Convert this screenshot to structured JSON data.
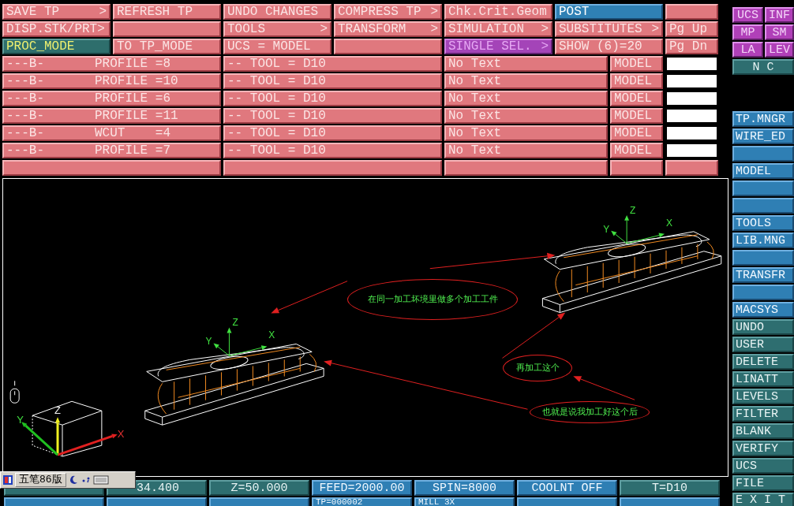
{
  "menu": [
    [
      {
        "label": "SAVE TP",
        "arrow": ">",
        "kind": "plain"
      },
      {
        "label": "REFRESH TP",
        "kind": "plain"
      },
      {
        "label": "UNDO CHANGES",
        "kind": "plain"
      },
      {
        "label": "COMPRESS TP",
        "arrow": ">",
        "kind": "plain"
      },
      {
        "label": "Chk.Crit.Geom",
        "kind": "plain"
      },
      {
        "label": "POST",
        "kind": "current"
      },
      {
        "kind": "plain"
      }
    ],
    [
      {
        "label": "DISP.STK/PRT>",
        "kind": "plain"
      },
      {
        "kind": "plain"
      },
      {
        "label": "TOOLS",
        "arrow": ">",
        "kind": "plain"
      },
      {
        "label": "TRANSFORM",
        "arrow": ">",
        "kind": "plain"
      },
      {
        "label": "SIMULATION",
        "arrow": ">",
        "kind": "plain"
      },
      {
        "label": "SUBSTITUTES",
        "arrow": ">",
        "kind": "plain"
      },
      {
        "label": "Pg Up",
        "kind": "plain"
      }
    ],
    [
      {
        "label": "PROC_MODE",
        "kind": "mode"
      },
      {
        "label": "TO TP_MODE",
        "kind": "plain"
      },
      {
        "label": "UCS = MODEL",
        "kind": "plain"
      },
      {
        "kind": "plain"
      },
      {
        "label": "SINGLE SEL.",
        "arrow": ">",
        "kind": "picked"
      },
      {
        "label": "SHOW (6)=20",
        "kind": "plain"
      },
      {
        "label": "Pg Dn",
        "kind": "plain"
      }
    ]
  ],
  "operations": [
    {
      "flag": "---B-",
      "name": "PROFILE =8",
      "tool": "-- TOOL = D10",
      "text": "No Text",
      "ref": "MODEL"
    },
    {
      "flag": "---B-",
      "name": "PROFILE =10",
      "tool": "-- TOOL = D10",
      "text": "No Text",
      "ref": "MODEL"
    },
    {
      "flag": "---B-",
      "name": "PROFILE =6",
      "tool": "-- TOOL = D10",
      "text": "No Text",
      "ref": "MODEL"
    },
    {
      "flag": "---B-",
      "name": "PROFILE =11",
      "tool": "-- TOOL = D10",
      "text": "No Text",
      "ref": "MODEL"
    },
    {
      "flag": "---B-",
      "name": "WCUT    =4",
      "tool": "-- TOOL = D10",
      "text": "No Text",
      "ref": "MODEL"
    },
    {
      "flag": "---B-",
      "name": "PROFILE =7",
      "tool": "-- TOOL = D10",
      "text": "No Text",
      "ref": "MODEL"
    }
  ],
  "viewport": {
    "workpieces": [
      {
        "axes": [
          "Z",
          "Y",
          "X"
        ]
      },
      {
        "axes": [
          "Z",
          "Y",
          "X"
        ]
      }
    ],
    "triad": {
      "axes": [
        "Z",
        "Y",
        "X"
      ]
    },
    "notes": [
      {
        "text": "在同一加工坏境里做多个加工工件"
      },
      {
        "text": "再加工这个"
      },
      {
        "text": "也就是说我加工好这个后"
      }
    ]
  },
  "status": [
    {
      "text": "34.400",
      "kind": "teal"
    },
    {
      "text": "Z=50.000",
      "kind": "teal"
    },
    {
      "text": "FEED=2000.00",
      "kind": "blue"
    },
    {
      "text": "SPIN=8000",
      "kind": "blue"
    },
    {
      "text": "COOLNT OFF",
      "kind": "blue"
    },
    {
      "text": "T=D10",
      "kind": "teal"
    }
  ],
  "status_row2": [
    "TP=000002",
    "MILL 3X"
  ],
  "ime_bar": {
    "label": "五笔86版"
  },
  "side_small": [
    [
      {
        "label": "UCS"
      },
      {
        "label": "INF"
      }
    ],
    [
      {
        "label": "MP"
      },
      {
        "label": "SM"
      }
    ],
    [
      {
        "label": "LA"
      },
      {
        "label": "LEV"
      }
    ]
  ],
  "side_mode": {
    "label": "N C"
  },
  "side_buttons": [
    {
      "label": "TP.MNGR",
      "kind": "blue"
    },
    {
      "label": "WIRE_ED",
      "kind": "blue"
    },
    {
      "kind": "blue"
    },
    {
      "label": "MODEL",
      "kind": "blue"
    },
    {
      "kind": "blue"
    },
    {
      "kind": "blue"
    },
    {
      "label": "TOOLS",
      "kind": "blue"
    },
    {
      "label": "LIB.MNG",
      "kind": "blue"
    },
    {
      "kind": "blue"
    },
    {
      "label": "TRANSFR",
      "kind": "blue"
    },
    {
      "kind": "blue"
    },
    {
      "label": "MACSYS",
      "kind": "blue"
    },
    {
      "label": "UNDO",
      "kind": "teal"
    },
    {
      "label": "USER",
      "kind": "teal"
    },
    {
      "label": "DELETE",
      "kind": "teal"
    },
    {
      "label": "LINATT",
      "kind": "teal"
    },
    {
      "label": "LEVELS",
      "kind": "teal"
    },
    {
      "label": "FILTER",
      "kind": "teal"
    },
    {
      "label": "BLANK",
      "kind": "teal"
    },
    {
      "label": "VERIFY",
      "kind": "teal"
    },
    {
      "label": "UCS",
      "kind": "teal"
    },
    {
      "label": "FILE",
      "kind": "teal"
    },
    {
      "label": "E X I T",
      "kind": "teal"
    }
  ]
}
